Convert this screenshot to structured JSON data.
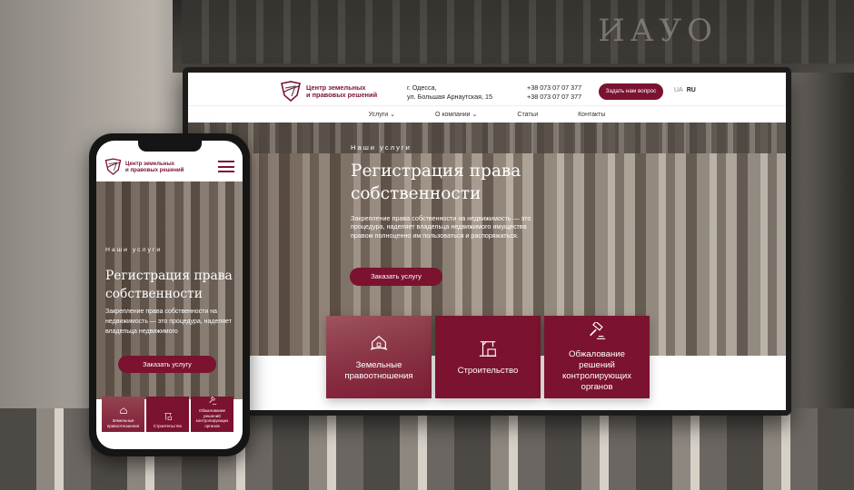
{
  "brand": {
    "name_line1": "Центр земельных",
    "name_line2": "и правовых решений",
    "accent_color": "#7b1230"
  },
  "desktop": {
    "address_line1": "г. Одесса,",
    "address_line2": "ул. Большая Арнаутская, 15",
    "phone1": "+38 073 07 07 377",
    "phone2": "+38 073 07 07 377",
    "ask_button": "Задать нам вопрос",
    "lang_ua": "UA",
    "lang_ru": "RU",
    "nav": [
      "Услуги",
      "О компании",
      "Статьи",
      "Контакты"
    ],
    "hero": {
      "eyebrow": "Наши услуги",
      "title": "Регистрация права собственности",
      "description": "Закрепление права собственности на недвижимость — это процедура, наделяет владельца недвижимого имущества правом полноценно им пользоваться и распоряжаться.",
      "cta": "Заказать услугу"
    },
    "cards": [
      {
        "label": "Земельные правоотношения",
        "icon": "house-hands-icon"
      },
      {
        "label": "Строительство",
        "icon": "construction-crane-icon"
      },
      {
        "label": "Обжалование решений контролирующих органов",
        "icon": "gavel-icon"
      }
    ]
  },
  "mobile": {
    "hero": {
      "eyebrow": "Наши услуги",
      "title": "Регистрация права собственности",
      "description": "Закрепление права собственности на недвижимость — это процедура, наделяет владельца недвижимого",
      "cta": "Заказать услугу"
    },
    "cards": [
      {
        "label": "Земельные правоотношения",
        "icon": "house-hands-icon"
      },
      {
        "label": "Строительство",
        "icon": "construction-crane-icon"
      },
      {
        "label": "Обжалование решений контролирующих органов",
        "icon": "gavel-icon"
      }
    ]
  },
  "background": {
    "inscription": "ИАУО"
  }
}
